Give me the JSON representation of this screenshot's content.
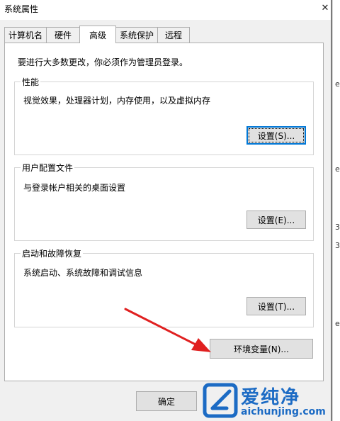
{
  "window": {
    "title": "系统属性",
    "close_glyph": "✕"
  },
  "tabs": [
    {
      "label": "计算机名"
    },
    {
      "label": "硬件"
    },
    {
      "label": "高级",
      "active": true
    },
    {
      "label": "系统保护"
    },
    {
      "label": "远程"
    }
  ],
  "notice": "要进行大多数更改，你必须作为管理员登录。",
  "groups": {
    "performance": {
      "title": "性能",
      "desc": "视觉效果，处理器计划，内存使用，以及虚拟内存",
      "button": "设置(S)..."
    },
    "profiles": {
      "title": "用户配置文件",
      "desc": "与登录帐户相关的桌面设置",
      "button": "设置(E)..."
    },
    "startup": {
      "title": "启动和故障恢复",
      "desc": "系统启动、系统故障和调试信息",
      "button": "设置(T)..."
    }
  },
  "env_button": "环境变量(N)...",
  "ok_button": "确定",
  "right_strip": {
    "marks": [
      "e",
      "e",
      "3",
      "3",
      "e"
    ]
  },
  "watermark": {
    "title": "爱纯净",
    "url": "aichunjing.com"
  },
  "colors": {
    "accent": "#0078d7",
    "arrow": "#e02020",
    "watermark": "#1c6bc4"
  }
}
